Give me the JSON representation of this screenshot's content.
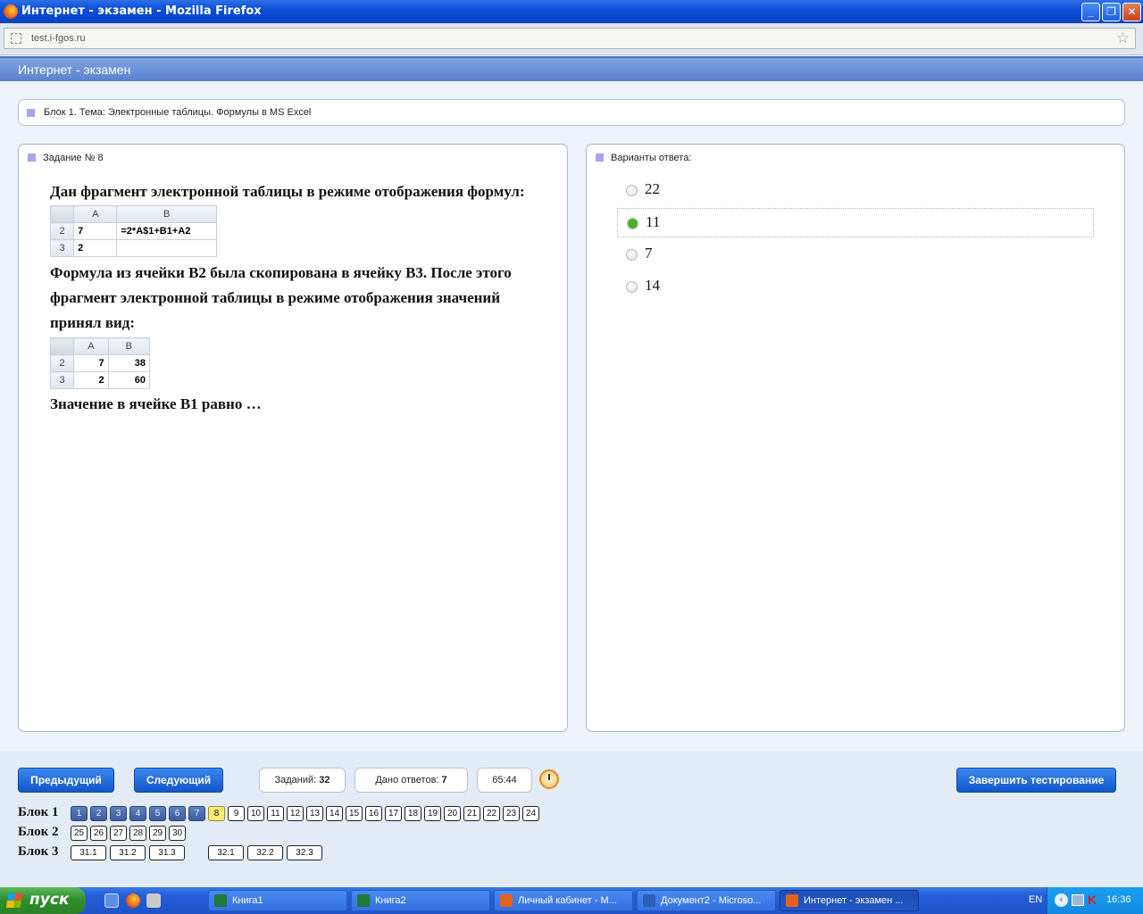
{
  "window": {
    "title": "Интернет - экзамен - Mozilla Firefox"
  },
  "browser": {
    "url": "test.i-fgos.ru"
  },
  "page": {
    "header": "Интернет - экзамен",
    "block_title": "Блок 1. Тема: Электронные таблицы. Формулы в MS Excel"
  },
  "question": {
    "heading": "Задание № 8",
    "intro": "Дан фрагмент электронной таблицы в режиме отображения формул:",
    "table1": {
      "cols": [
        "A",
        "B"
      ],
      "rows": [
        {
          "num": "2",
          "a": "7",
          "b": "=2*A$1+B1+A2"
        },
        {
          "num": "3",
          "a": "2",
          "b": ""
        }
      ]
    },
    "mid_1": "Формула из ячейки",
    "mid_b2": "B2",
    "mid_2": "была скопирована в ячейку",
    "mid_b3": "B3",
    "mid_3": ".  После этого",
    "mid_line2": "фрагмент электронной таблицы в режиме отображения значений",
    "mid_line3": "принял вид:",
    "table2": {
      "cols": [
        "A",
        "B"
      ],
      "rows": [
        {
          "num": "2",
          "a": "7",
          "b": "38"
        },
        {
          "num": "3",
          "a": "2",
          "b": "60"
        }
      ]
    },
    "end_1": "Значение в ячейке",
    "end_b1": "B1",
    "end_2": "равно …"
  },
  "answers": {
    "heading": "Варианты ответа:",
    "options": [
      {
        "label": "22",
        "selected": false
      },
      {
        "label": "11",
        "selected": true
      },
      {
        "label": "7",
        "selected": false
      },
      {
        "label": "14",
        "selected": false
      }
    ]
  },
  "controls": {
    "prev": "Предыдущий",
    "next": "Следующий",
    "tasks_label": "Заданий:",
    "tasks_count": "32",
    "answered_label": "Дано ответов:",
    "answered_count": "7",
    "timer": "65:44",
    "finish": "Завершить тестирование"
  },
  "blocks": [
    {
      "label": "Блок 1",
      "items": [
        "1",
        "2",
        "3",
        "4",
        "5",
        "6",
        "7",
        "8",
        "9",
        "10",
        "11",
        "12",
        "13",
        "14",
        "15",
        "16",
        "17",
        "18",
        "19",
        "20",
        "21",
        "22",
        "23",
        "24"
      ]
    },
    {
      "label": "Блок 2",
      "items": [
        "25",
        "26",
        "27",
        "28",
        "29",
        "30"
      ]
    },
    {
      "label": "Блок 3",
      "items": [
        "31.1",
        "31.2",
        "31.3",
        "32.1",
        "32.2",
        "32.3"
      ]
    }
  ],
  "block_status": {
    "answered": [
      "1",
      "2",
      "3",
      "4",
      "5",
      "6",
      "7"
    ],
    "current": "8"
  },
  "taskbar": {
    "start": "пуск",
    "tasks": [
      "Книга1",
      "Книга2",
      "Личный кабинет - M...",
      "Документ2 - Microso...",
      "Интернет - экзамен ..."
    ],
    "lang": "EN",
    "clock": "16:36"
  },
  "colors": {
    "accent": "#1257c9",
    "answered": "#3c5ea0",
    "current": "#ffec78",
    "selected_radio": "#4ab325"
  }
}
